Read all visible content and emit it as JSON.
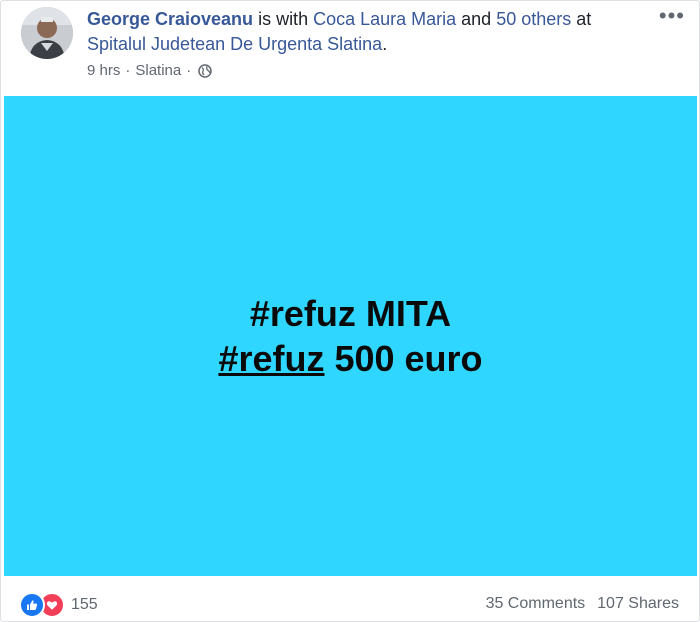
{
  "post": {
    "author": "George Craioveanu",
    "header_middle": " is with ",
    "tagged_person": "Coca Laura Maria",
    "header_and": " and ",
    "tagged_others": "50 others",
    "header_at": " at ",
    "location": "Spitalul Judetean De Urgenta Slatina",
    "header_end": ".",
    "time": "9 hrs",
    "separator": "·",
    "place": "Slatina",
    "privacy_icon": "globe-icon",
    "more_label": "•••"
  },
  "media": {
    "background_color": "#2fd6ff",
    "line1": "#refuz MITA",
    "line2_link": "#refuz",
    "line2_rest": " 500 euro"
  },
  "footer": {
    "reaction_icons": [
      "like-icon",
      "love-icon"
    ],
    "reaction_count": "155",
    "comments": "35 Comments",
    "shares": "107 Shares"
  },
  "colors": {
    "link": "#385898",
    "meta": "#616770",
    "like": "#1877f2",
    "love": "#f33e58"
  }
}
